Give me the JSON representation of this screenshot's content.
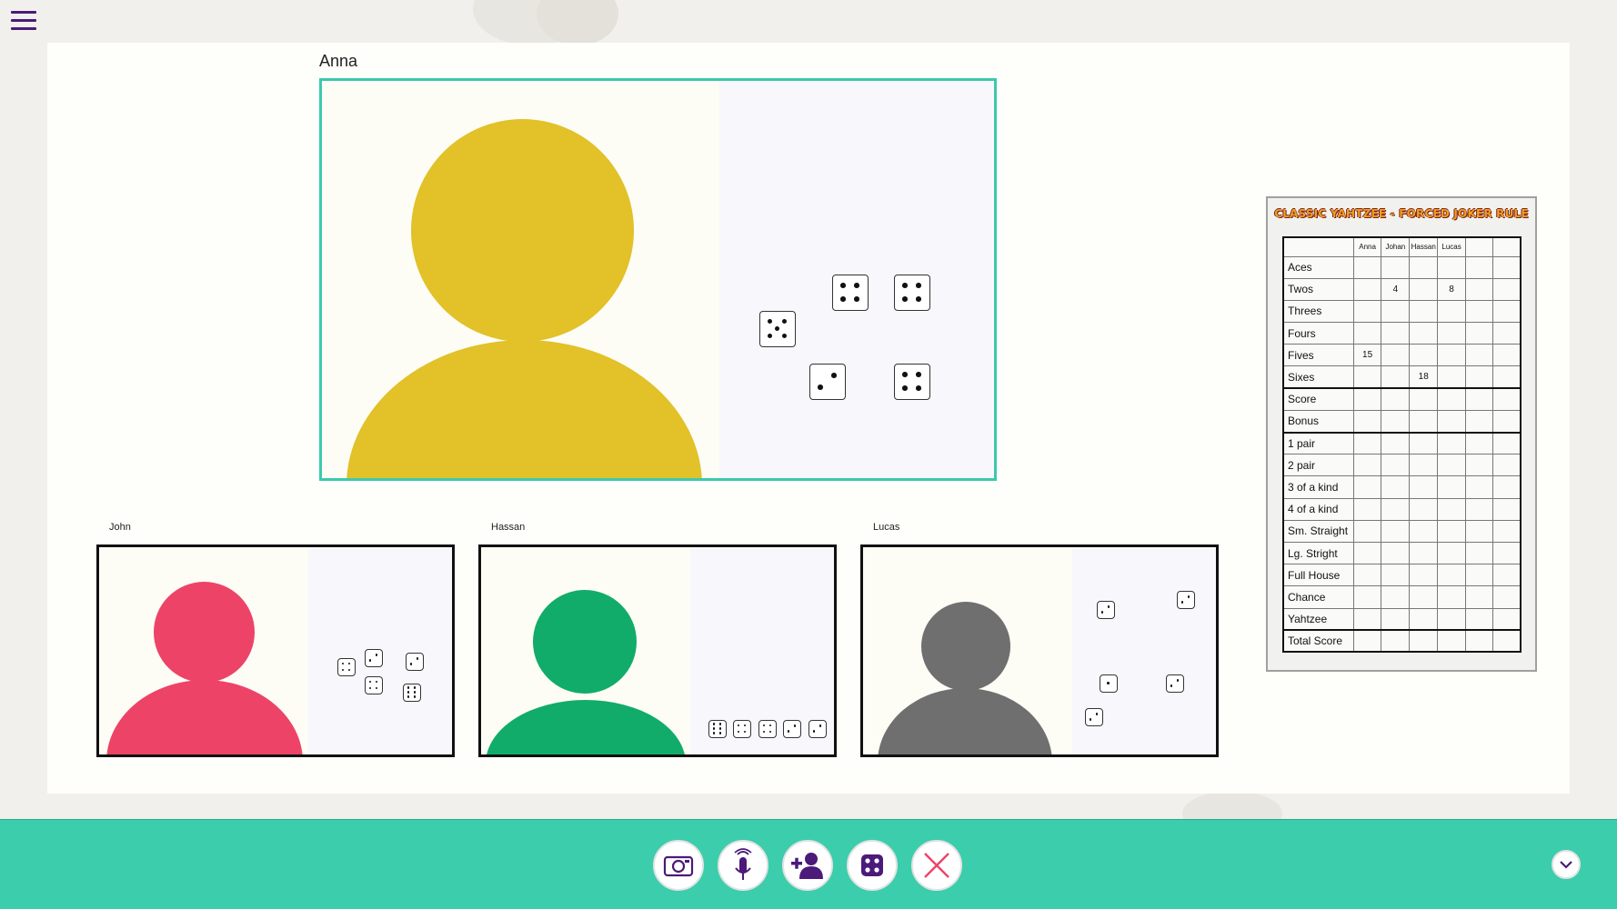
{
  "menu": {
    "icon": "hamburger-menu-icon"
  },
  "players": {
    "main": {
      "name": "Anna",
      "color": "#e2c129"
    },
    "john": {
      "name": "John",
      "color": "#ed4367"
    },
    "hassan": {
      "name": "Hassan",
      "color": "#11ac69"
    },
    "lucas": {
      "name": "Lucas",
      "color": "#6f6f6f"
    }
  },
  "scorecard": {
    "title": "CLASSIC YAHTZEE - FORCED JOKER RULE",
    "columns": [
      "Anna",
      "Johan",
      "Hassan",
      "Lucas",
      "",
      ""
    ],
    "rows": [
      {
        "label": "Aces",
        "values": [
          "",
          "",
          "",
          "",
          "",
          ""
        ]
      },
      {
        "label": "Twos",
        "values": [
          "",
          "4",
          "",
          "8",
          "",
          ""
        ]
      },
      {
        "label": "Threes",
        "values": [
          "",
          "",
          "",
          "",
          "",
          ""
        ]
      },
      {
        "label": "Fours",
        "values": [
          "",
          "",
          "",
          "",
          "",
          ""
        ]
      },
      {
        "label": "Fives",
        "values": [
          "15",
          "",
          "",
          "",
          "",
          ""
        ]
      },
      {
        "label": "Sixes",
        "values": [
          "",
          "",
          "18",
          "",
          "",
          ""
        ]
      },
      {
        "label": "Score",
        "values": [
          "",
          "",
          "",
          "",
          "",
          ""
        ]
      },
      {
        "label": "Bonus",
        "values": [
          "",
          "",
          "",
          "",
          "",
          ""
        ]
      },
      {
        "label": "1 pair",
        "values": [
          "",
          "",
          "",
          "",
          "",
          ""
        ]
      },
      {
        "label": "2 pair",
        "values": [
          "",
          "",
          "",
          "",
          "",
          ""
        ]
      },
      {
        "label": "3 of a kind",
        "values": [
          "",
          "",
          "",
          "",
          "",
          ""
        ]
      },
      {
        "label": "4 of a kind",
        "values": [
          "",
          "",
          "",
          "",
          "",
          ""
        ]
      },
      {
        "label": "Sm. Straight",
        "values": [
          "",
          "",
          "",
          "",
          "",
          ""
        ]
      },
      {
        "label": "Lg. Stright",
        "values": [
          "",
          "",
          "",
          "",
          "",
          ""
        ]
      },
      {
        "label": "Full House",
        "values": [
          "",
          "",
          "",
          "",
          "",
          ""
        ]
      },
      {
        "label": "Chance",
        "values": [
          "",
          "",
          "",
          "",
          "",
          ""
        ]
      },
      {
        "label": "Yahtzee",
        "values": [
          "",
          "",
          "",
          "",
          "",
          ""
        ]
      },
      {
        "label": "Total Score",
        "values": [
          "",
          "",
          "",
          "",
          "",
          ""
        ]
      }
    ]
  },
  "toolbar": {
    "buttons": [
      {
        "name": "camera-button",
        "icon": "camera-icon"
      },
      {
        "name": "microphone-button",
        "icon": "microphone-icon"
      },
      {
        "name": "add-player-button",
        "icon": "add-user-icon"
      },
      {
        "name": "dice-button",
        "icon": "dice-icon"
      },
      {
        "name": "leave-button",
        "icon": "close-icon"
      }
    ],
    "collapse_icon": "chevron-down-icon",
    "accent": "#4b1a7a",
    "danger": "#ed4367"
  },
  "dice": {
    "main": [
      4,
      4,
      5,
      2,
      4
    ],
    "john": [
      4,
      2,
      2,
      4,
      6
    ],
    "hassan": [
      6,
      4,
      4,
      2,
      2
    ],
    "lucas": [
      2,
      2,
      1,
      2,
      2
    ]
  }
}
